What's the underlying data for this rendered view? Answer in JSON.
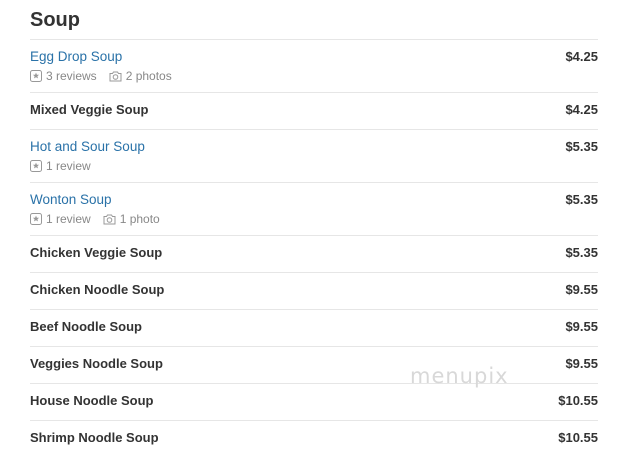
{
  "section": {
    "title": "Soup"
  },
  "items": [
    {
      "name": "Egg Drop Soup",
      "price": "$4.25",
      "reviews": "3 reviews",
      "photos": "2 photos"
    },
    {
      "name": "Mixed Veggie Soup",
      "price": "$4.25"
    },
    {
      "name": "Hot and Sour Soup",
      "price": "$5.35",
      "reviews": "1 review"
    },
    {
      "name": "Wonton Soup",
      "price": "$5.35",
      "reviews": "1 review",
      "photos": "1 photo"
    },
    {
      "name": "Chicken Veggie Soup",
      "price": "$5.35"
    },
    {
      "name": "Chicken Noodle Soup",
      "price": "$9.55"
    },
    {
      "name": "Beef Noodle Soup",
      "price": "$9.55"
    },
    {
      "name": "Veggies Noodle Soup",
      "price": "$9.55"
    },
    {
      "name": "House Noodle Soup",
      "price": "$10.55"
    },
    {
      "name": "Shrimp Noodle Soup",
      "price": "$10.55"
    }
  ],
  "watermark": "menupix",
  "colors": {
    "link": "#2a72a8",
    "text": "#333333",
    "meta": "#888888",
    "divider": "#e6e6e6"
  },
  "icons": {
    "review": "star-box-icon",
    "photo": "camera-icon"
  }
}
